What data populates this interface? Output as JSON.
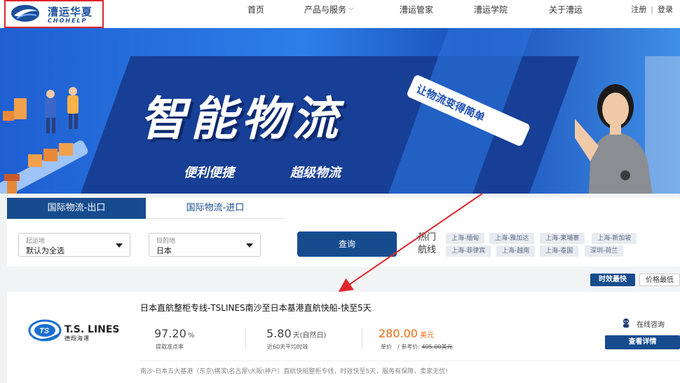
{
  "logo": {
    "name_cn": "漕运华夏",
    "name_en": "CHOHELP"
  },
  "nav": {
    "items": [
      {
        "label": "首页"
      },
      {
        "label": "产品与服务"
      },
      {
        "label": "漕运管家"
      },
      {
        "label": "漕运学院"
      },
      {
        "label": "关于漕运"
      }
    ],
    "register": "注册",
    "separator": "|",
    "login": "登录"
  },
  "banner": {
    "headline": "智能物流",
    "sub_left": "便利便捷",
    "sub_right": "超级物流",
    "slogan": "让物流变得简单"
  },
  "search": {
    "tabs": [
      {
        "label": "国际物流-出口",
        "active": true
      },
      {
        "label": "国际物流-进口",
        "active": false
      }
    ],
    "origin": {
      "label": "起运地",
      "value": "默认为全选"
    },
    "destination": {
      "label": "目的地",
      "value": "日本"
    },
    "query_label": "查询",
    "hot_routes_label": "热门航线",
    "hot_routes": [
      "上海-缅甸",
      "上海-雅加达",
      "上海-柬埔寨",
      "上海-新加坡",
      "上海-菲律宾",
      "上海-越南",
      "上海-泰国",
      "深圳-荷兰"
    ]
  },
  "sort": {
    "fastest": "时效最快",
    "cheapest": "价格最低"
  },
  "result": {
    "carrier_name": "T.S. LINES",
    "carrier_name_cn": "德翔海運",
    "title": "日本直航整柜专线-TSLINES南沙至日本基港直航快船-快至5天",
    "accuracy_value": "97.20",
    "accuracy_unit": "%",
    "accuracy_label": "提取准点率",
    "avg_time_value": "5.80",
    "avg_time_unit": "天(自然日)",
    "avg_time_label": "近60天平均时效",
    "price_value": "280.00",
    "price_currency": "美元",
    "price_unit_label": "单价",
    "ref_price_label": "/ 参考价:",
    "ref_price_value": "405.00美元",
    "consult_label": "在线咨询",
    "detail_button": "查看详情",
    "description": "南沙-日本五大基港（东京\\横滨\\名古屋\\大阪\\神户）直航快船整柜专线，时效快至5天，服务有保障，卖家无忧!"
  },
  "colors": {
    "primary": "#164c8e",
    "price_orange": "#f06a0f",
    "annotation_red": "#e0262b",
    "banner_blue": "#1f5fd1"
  }
}
